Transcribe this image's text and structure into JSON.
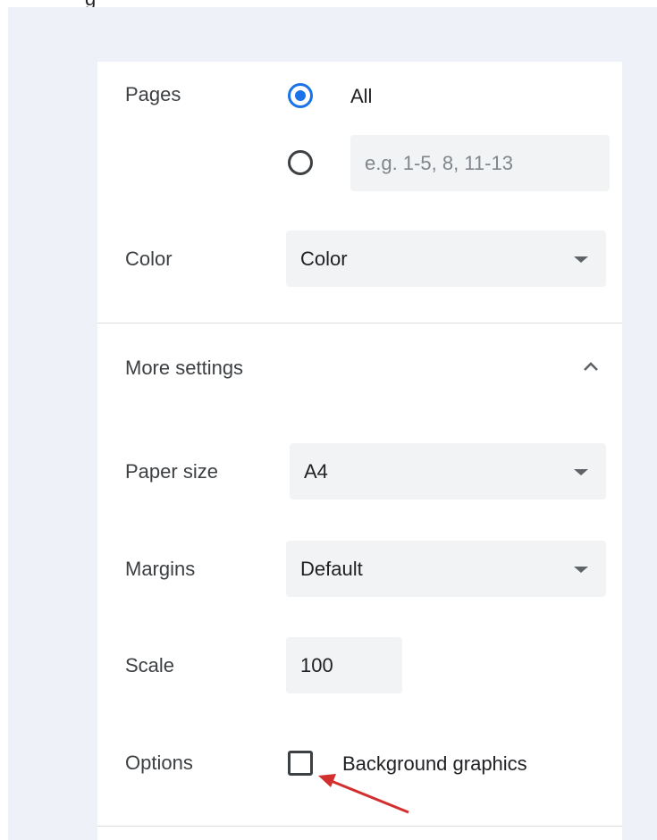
{
  "pages": {
    "label": "Pages",
    "option_all_label": "All",
    "option_custom_placeholder": "e.g. 1-5, 8, 11-13",
    "selected": "all"
  },
  "color": {
    "label": "Color",
    "selected_value": "Color"
  },
  "more_settings": {
    "label": "More settings",
    "expanded": true,
    "toggle_icon": "chevron-up-icon"
  },
  "paper_size": {
    "label": "Paper size",
    "selected_value": "A4"
  },
  "margins": {
    "label": "Margins",
    "selected_value": "Default"
  },
  "scale": {
    "label": "Scale",
    "value": "100"
  },
  "options": {
    "label": "Options",
    "background_graphics_label": "Background graphics",
    "background_graphics_checked": false
  },
  "colors": {
    "accent": "#1a73e8",
    "background": "#eef1f8",
    "field_bg": "#f1f3f4",
    "annotation_arrow": "#d32f2f"
  }
}
